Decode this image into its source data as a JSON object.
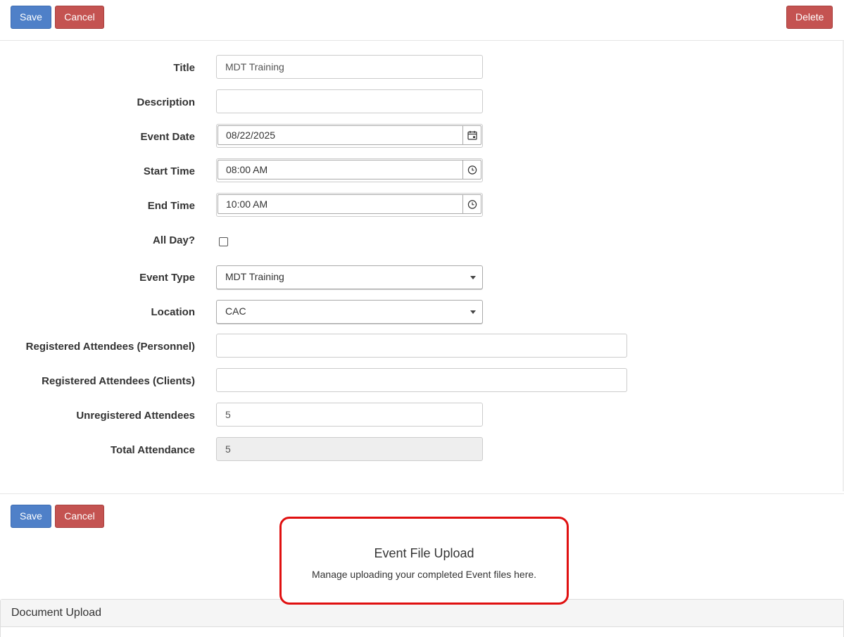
{
  "toolbar_top": {
    "save": "Save",
    "cancel": "Cancel",
    "delete": "Delete"
  },
  "toolbar_bottom": {
    "save": "Save",
    "cancel": "Cancel"
  },
  "form": {
    "title": {
      "label": "Title",
      "value": "MDT Training"
    },
    "description": {
      "label": "Description",
      "value": ""
    },
    "event_date": {
      "label": "Event Date",
      "value": "08/22/2025",
      "icon": "calendar-icon"
    },
    "start_time": {
      "label": "Start Time",
      "value": "08:00 AM",
      "icon": "clock-icon"
    },
    "end_time": {
      "label": "End Time",
      "value": "10:00 AM",
      "icon": "clock-icon"
    },
    "all_day": {
      "label": "All Day?",
      "checked": false
    },
    "event_type": {
      "label": "Event Type",
      "value": "MDT Training"
    },
    "location": {
      "label": "Location",
      "value": "CAC"
    },
    "attendees_personnel": {
      "label": "Registered Attendees (Personnel)",
      "value": ""
    },
    "attendees_clients": {
      "label": "Registered Attendees (Clients)",
      "value": ""
    },
    "unregistered": {
      "label": "Unregistered Attendees",
      "value": "5"
    },
    "total": {
      "label": "Total Attendance",
      "value": "5"
    }
  },
  "upload": {
    "title": "Event File Upload",
    "subtitle": "Manage uploading your completed Event files here."
  },
  "document_panel": {
    "heading": "Document Upload"
  },
  "colors": {
    "primary": "#4f80c8",
    "danger": "#c45351",
    "highlight": "#e01010"
  }
}
